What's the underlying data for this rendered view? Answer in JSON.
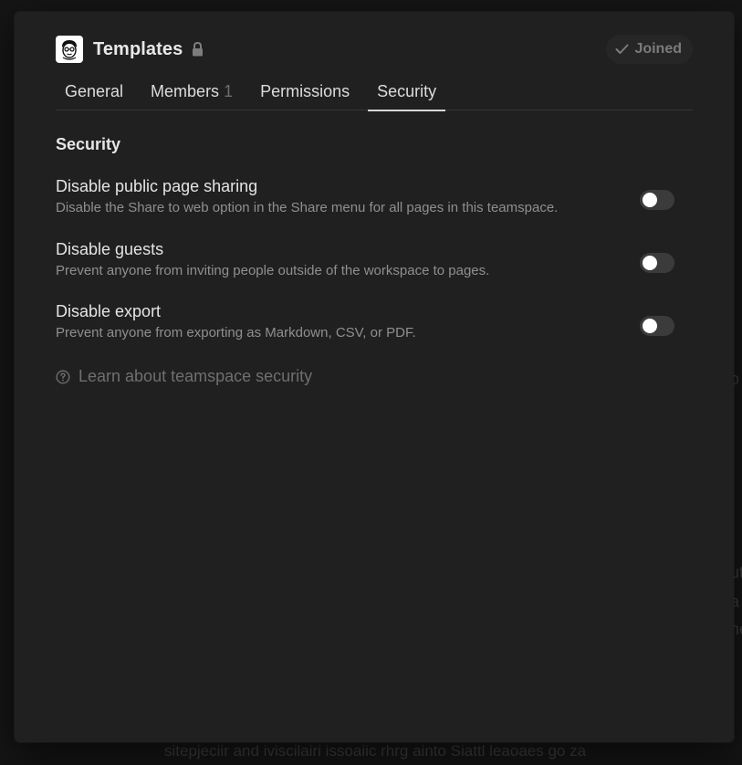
{
  "background": {
    "fragments": [
      "o",
      "ut",
      "a",
      "ne",
      "sitepjeciir and iviscilairi issoaiic rhrg ainto Siattl leaoaes go za"
    ]
  },
  "header": {
    "avatar_icon": "cartoon-face-icon",
    "team_name": "Templates",
    "lock_icon": "lock-icon",
    "joined_label": "Joined"
  },
  "tabs": [
    {
      "label": "General",
      "count": ""
    },
    {
      "label": "Members",
      "count": "1"
    },
    {
      "label": "Permissions",
      "count": ""
    },
    {
      "label": "Security",
      "count": "",
      "active": true
    }
  ],
  "section": {
    "title": "Security"
  },
  "settings": [
    {
      "title": "Disable public page sharing",
      "description": "Disable the Share to web option in the Share menu for all pages in this teamspace.",
      "enabled": false
    },
    {
      "title": "Disable guests",
      "description": "Prevent anyone from inviting people outside of the workspace to pages.",
      "enabled": false
    },
    {
      "title": "Disable export",
      "description": "Prevent anyone from exporting as Markdown, CSV, or PDF.",
      "enabled": false
    }
  ],
  "learn_link": {
    "label": "Learn about teamspace security",
    "icon": "help-circle-icon"
  },
  "colors": {
    "modal_bg": "#202020",
    "toggle_off": "#3b3b3b",
    "muted_text": "#8f8f8f"
  }
}
